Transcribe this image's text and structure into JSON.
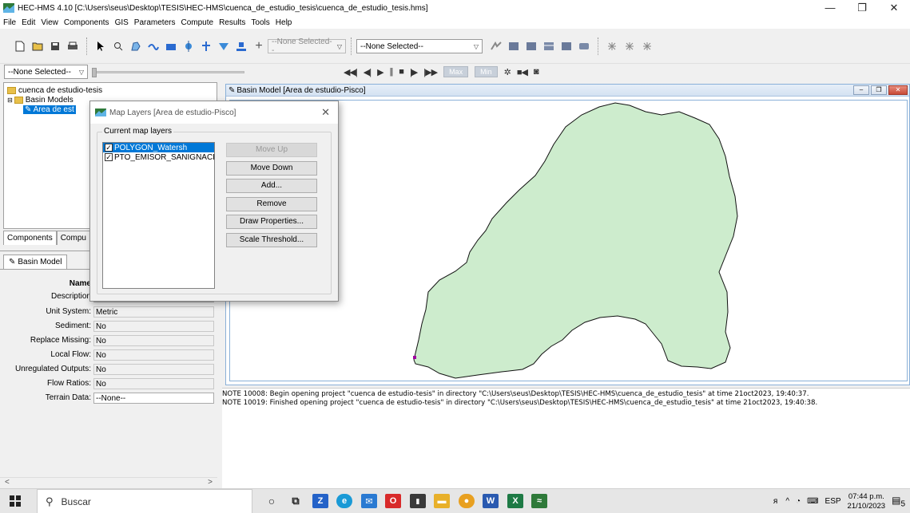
{
  "window": {
    "title": "HEC-HMS 4.10 [C:\\Users\\seus\\Desktop\\TESIS\\HEC-HMS\\cuenca_de_estudio_tesis\\cuenca_de_estudio_tesis.hms]",
    "minimize": "—",
    "maximize": "❐",
    "close": "✕"
  },
  "menu": [
    "File",
    "Edit",
    "View",
    "Components",
    "GIS",
    "Parameters",
    "Compute",
    "Results",
    "Tools",
    "Help"
  ],
  "toolbar": {
    "element_combo": "--None Selected--",
    "run_combo": "--None Selected--",
    "left_combo": "--None Selected--",
    "max_label": "Max",
    "min_label": "Min"
  },
  "tree": {
    "project": "cuenca de estudio-tesis",
    "basin_models": "Basin Models",
    "basin_item": "Area de est"
  },
  "left_tabs": [
    "Components",
    "Compu"
  ],
  "properties": {
    "tab": "Basin Model",
    "rows": [
      {
        "label": "Name",
        "value": ""
      },
      {
        "label": "Description",
        "value": ""
      },
      {
        "label": "Unit System:",
        "value": "Metric"
      },
      {
        "label": "Sediment:",
        "value": "No"
      },
      {
        "label": "Replace Missing:",
        "value": "No"
      },
      {
        "label": "Local Flow:",
        "value": "No"
      },
      {
        "label": "Unregulated Outputs:",
        "value": "No"
      },
      {
        "label": "Flow Ratios:",
        "value": "No"
      },
      {
        "label": "Terrain Data:",
        "value": "--None--"
      }
    ]
  },
  "basin": {
    "title": "Basin Model [Area de estudio-Pisco]",
    "fill_color": "#cdeccd",
    "outlet_color": "#a000a0"
  },
  "dialog": {
    "title": "Map Layers [Area de estudio-Pisco]",
    "group": "Current map layers",
    "layers": [
      {
        "name": "POLYGON_Watersh",
        "checked": true,
        "selected": true
      },
      {
        "name": "PTO_EMISOR_SANIGNACI",
        "checked": true,
        "selected": false
      }
    ],
    "buttons": {
      "move_up": "Move Up",
      "move_down": "Move Down",
      "add": "Add...",
      "remove": "Remove",
      "draw": "Draw Properties...",
      "scale": "Scale Threshold..."
    }
  },
  "messages": [
    "NOTE 10008:  Begin opening project \"cuenca de estudio-tesis\" in directory \"C:\\Users\\seus\\Desktop\\TESIS\\HEC-HMS\\cuenca_de_estudio_tesis\" at time 21oct2023, 19:40:37.",
    "NOTE 10019:  Finished opening project \"cuenca de estudio-tesis\" in directory \"C:\\Users\\seus\\Desktop\\TESIS\\HEC-HMS\\cuenca_de_estudio_tesis\" at time 21oct2023, 19:40:38."
  ],
  "taskbar": {
    "search": "Buscar",
    "lang": "ESP",
    "time": "07:44 p.m.",
    "date": "21/10/2023",
    "notif_count": "5"
  }
}
